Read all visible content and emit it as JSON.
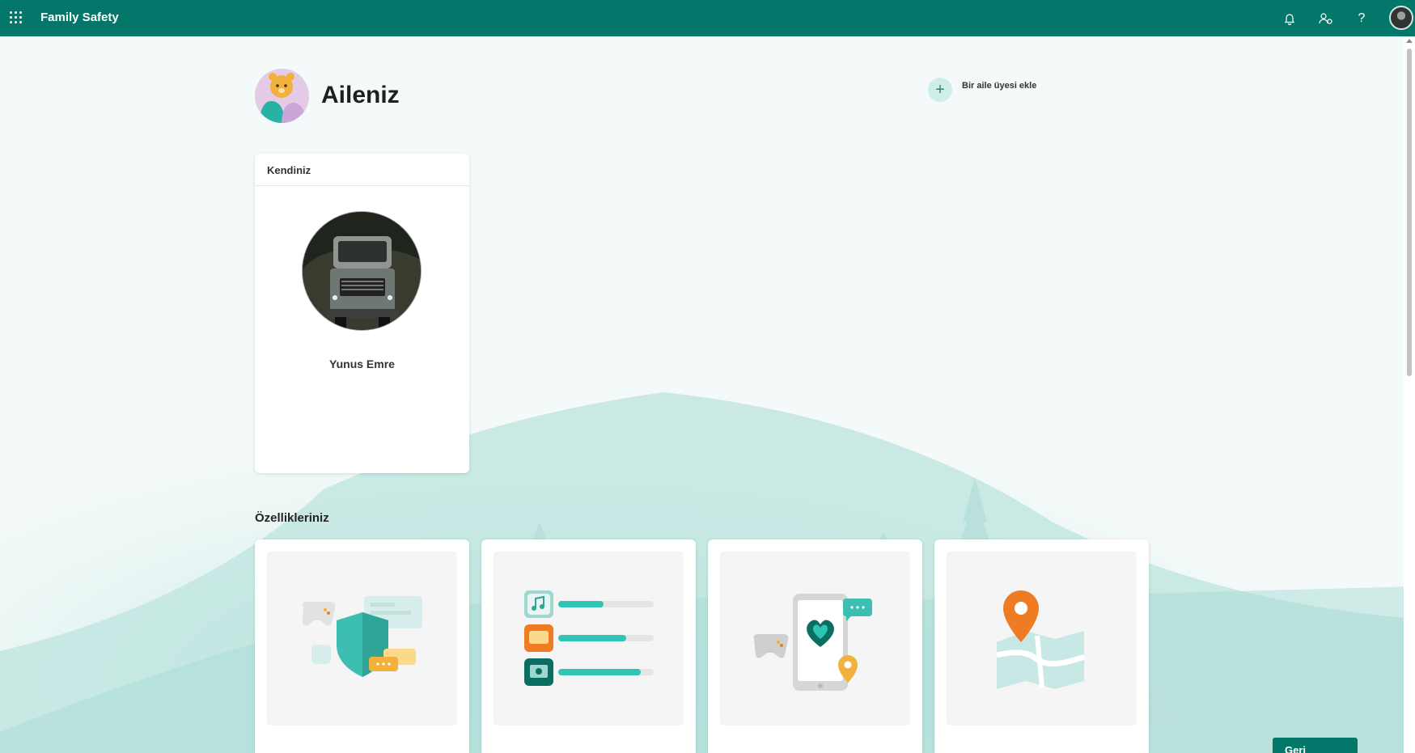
{
  "app": {
    "title": "Family Safety"
  },
  "topbar": {
    "icons": [
      "app-launcher-icon",
      "bell-icon",
      "family-settings-icon",
      "help-icon",
      "account-avatar"
    ]
  },
  "header": {
    "title": "Aileniz",
    "add_member_label": "Bir aile üyesi ekle",
    "add_member_icon": "plus-icon"
  },
  "member_card": {
    "header": "Kendiniz",
    "name": "Yunus Emre"
  },
  "features": {
    "title": "Özellikleriniz",
    "cards": [
      {
        "illustration": "shield-controller-illustration"
      },
      {
        "illustration": "app-usage-bars-illustration"
      },
      {
        "illustration": "phone-heart-illustration"
      },
      {
        "illustration": "location-map-illustration"
      }
    ]
  },
  "feedback_label": "Geri bildirim",
  "colors": {
    "brand": "#03786a",
    "accent_light": "#cfeeea",
    "orange": "#ef7c22",
    "teal": "#2fc5b5"
  }
}
